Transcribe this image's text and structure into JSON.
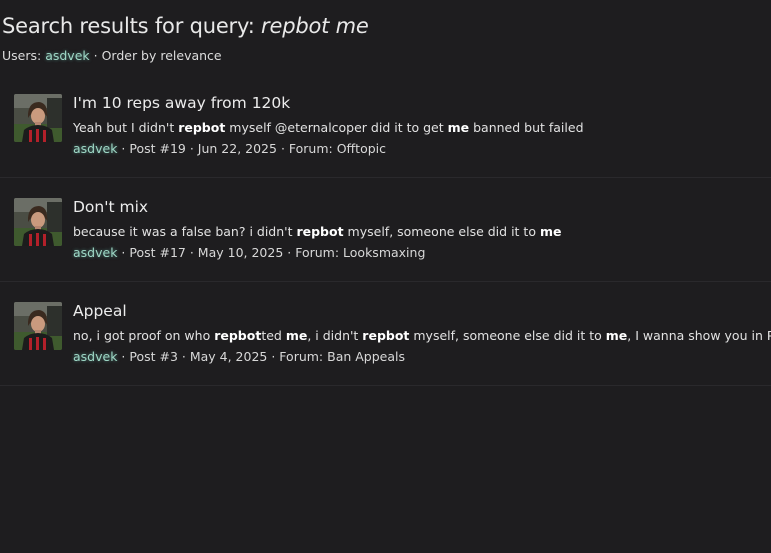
{
  "header": {
    "title_prefix": "Search results for query: ",
    "query": "repbot me"
  },
  "filters": {
    "users_label": "Users: ",
    "user": "asdvek",
    "separator": " · ",
    "order": "Order by relevance"
  },
  "results": [
    {
      "title": "I'm 10 reps away from 120k",
      "snippet": [
        {
          "text": "Yeah but I didn't ",
          "bold": false
        },
        {
          "text": "repbot",
          "bold": true
        },
        {
          "text": " myself @eternalcoper did it to get ",
          "bold": false
        },
        {
          "text": "me",
          "bold": true
        },
        {
          "text": " banned but failed",
          "bold": false
        }
      ],
      "author": "asdvek",
      "post": "Post #19",
      "date": "Jun 22, 2025",
      "forum_label": "Forum: ",
      "forum": "Offtopic",
      "avatar_icon": "user-avatar-photo"
    },
    {
      "title": "Don't mix",
      "snippet": [
        {
          "text": "because it was a false ban? i didn't ",
          "bold": false
        },
        {
          "text": "repbot",
          "bold": true
        },
        {
          "text": " myself, someone else did it to ",
          "bold": false
        },
        {
          "text": "me",
          "bold": true
        }
      ],
      "author": "asdvek",
      "post": "Post #17",
      "date": "May 10, 2025",
      "forum_label": "Forum: ",
      "forum": "Looksmaxing",
      "avatar_icon": "user-avatar-photo"
    },
    {
      "title": "Appeal",
      "snippet": [
        {
          "text": "no, i got proof on who ",
          "bold": false
        },
        {
          "text": "repbot",
          "bold": true
        },
        {
          "text": "ted ",
          "bold": false
        },
        {
          "text": "me",
          "bold": true
        },
        {
          "text": ", i didn't ",
          "bold": false
        },
        {
          "text": "repbot",
          "bold": true
        },
        {
          "text": " myself, someone else did it to ",
          "bold": false
        },
        {
          "text": "me",
          "bold": true
        },
        {
          "text": ", I wanna show you in PMs",
          "bold": false
        }
      ],
      "author": "asdvek",
      "post": "Post #3",
      "date": "May 4, 2025",
      "forum_label": "Forum: ",
      "forum": "Ban Appeals",
      "avatar_icon": "user-avatar-photo"
    }
  ],
  "colors": {
    "background": "#1e1d1f",
    "username": "#9fd8c6",
    "text": "#e6e6e6"
  }
}
